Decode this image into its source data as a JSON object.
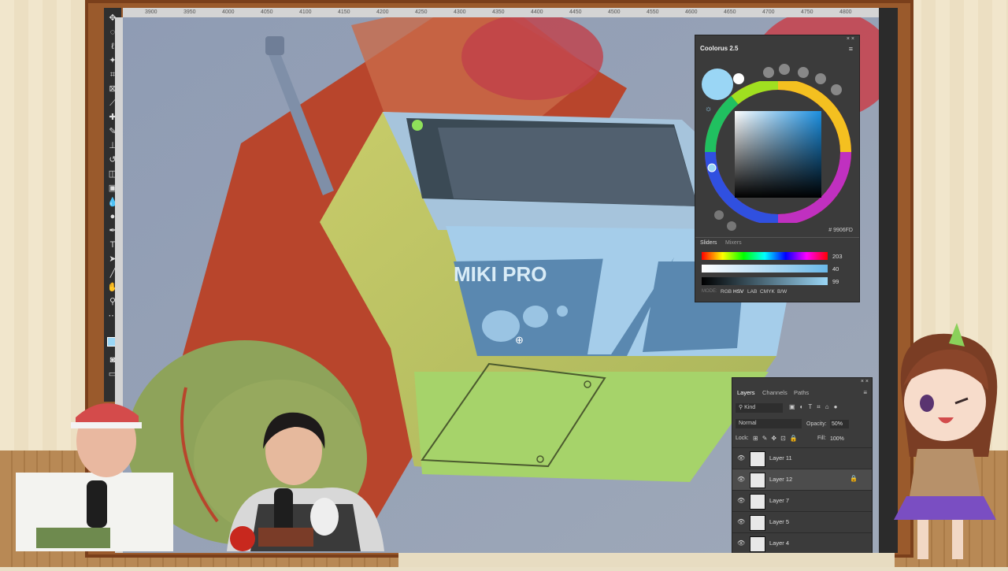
{
  "ruler": {
    "ticks": [
      "3900",
      "3950",
      "4000",
      "4050",
      "4100",
      "4150",
      "4200",
      "4250",
      "4300",
      "4350",
      "4400",
      "4450",
      "4500",
      "4550",
      "4600",
      "4650",
      "4700",
      "4750",
      "4800"
    ]
  },
  "artwork": {
    "device_label": "MIKI PRO"
  },
  "coolorus": {
    "title": "Coolorus 2.5",
    "hex": "# 9906FD",
    "tabs": [
      "Sliders",
      "Mixers"
    ],
    "slider_values": [
      "203",
      "40",
      "99"
    ],
    "mode_label": "MODE:",
    "modes": [
      "RGB",
      "HSV",
      "LAB",
      "CMYK",
      "B/W"
    ],
    "accent_color": "#9ad6f5"
  },
  "layers_panel": {
    "tabs": [
      "Layers",
      "Channels",
      "Paths"
    ],
    "filter": "Kind",
    "blend_mode": "Normal",
    "opacity_label": "Opacity:",
    "opacity_value": "50%",
    "lock_label": "Lock:",
    "fill_label": "Fill:",
    "fill_value": "100%",
    "layers": [
      {
        "name": "Layer 11",
        "selected": false
      },
      {
        "name": "Layer 12",
        "selected": true
      },
      {
        "name": "Layer 7",
        "selected": false
      },
      {
        "name": "Layer 5",
        "selected": false
      },
      {
        "name": "Layer 4",
        "selected": false
      }
    ]
  }
}
